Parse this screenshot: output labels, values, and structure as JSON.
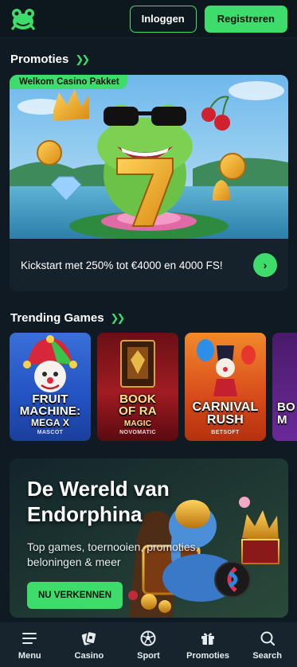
{
  "header": {
    "logo_icon": "frog-logo-icon",
    "login_label": "Inloggen",
    "register_label": "Registreren"
  },
  "promos": {
    "title": "Promoties",
    "card": {
      "tag": "Welkom Casino Pakket",
      "text": "Kickstart met 250% tot €4000 en 4000 FS!",
      "image_icon": "frog-with-lucky-seven-illustration"
    }
  },
  "trending": {
    "title": "Trending Games",
    "games": [
      {
        "title_line1": "FRUIT",
        "title_line2": "MACHINE:",
        "title_line3": "MEGA X",
        "provider": "MASCOT"
      },
      {
        "title_line1": "BOOK",
        "title_line2": "OF RA",
        "title_line3": "MAGIC",
        "provider": "NOVOMATIC"
      },
      {
        "title_line1": "CARNIVAL",
        "title_line2": "RUSH",
        "title_line3": "",
        "provider": "BETSOFT"
      },
      {
        "title_line1": "BO",
        "title_line2": "M",
        "title_line3": "",
        "provider": ""
      }
    ]
  },
  "banner": {
    "title_line1": "De Wereld van",
    "title_line2": "Endorphina",
    "subtitle": "Top games, toernooien, promoties, beloningen & meer",
    "button_label": "NU VERKENNEN"
  },
  "nav": {
    "items": [
      {
        "label": "Menu",
        "icon": "menu-icon"
      },
      {
        "label": "Casino",
        "icon": "casino-chip-icon"
      },
      {
        "label": "Sport",
        "icon": "soccer-ball-icon"
      },
      {
        "label": "Promoties",
        "icon": "gift-icon"
      },
      {
        "label": "Search",
        "icon": "search-icon"
      }
    ]
  },
  "colors": {
    "accent": "#3ddc6b",
    "background": "#0f1a22",
    "nav_background": "#17242d"
  }
}
